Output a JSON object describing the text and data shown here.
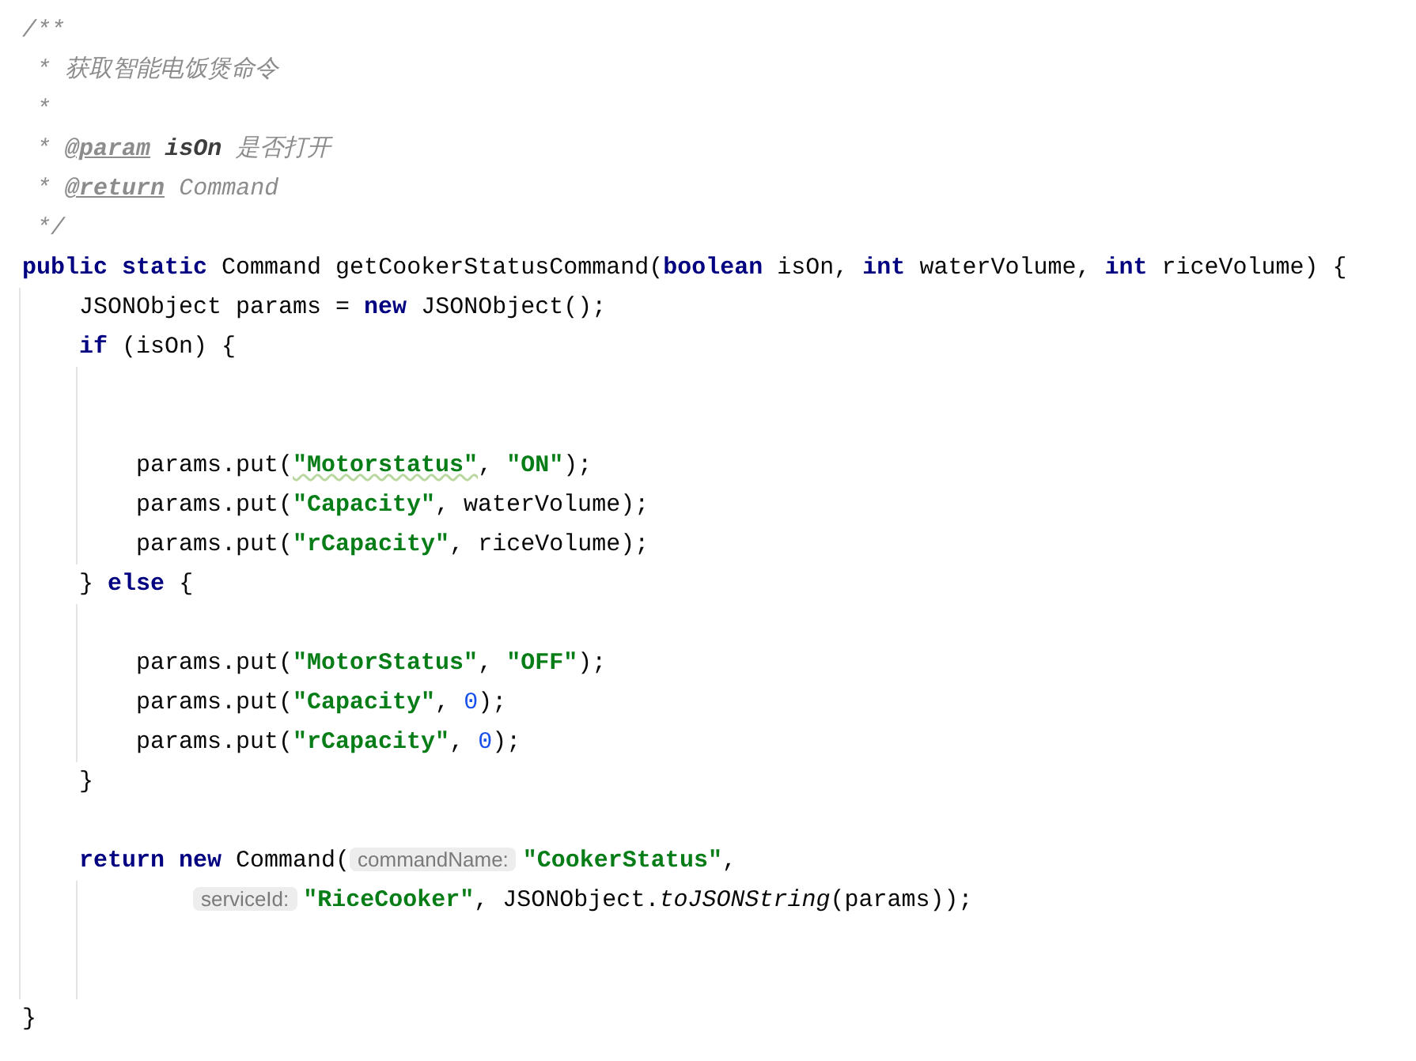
{
  "lines": [
    {
      "tokens": [
        {
          "kind": "comment",
          "text": "/**"
        }
      ]
    },
    {
      "doc": true,
      "tokens": [
        {
          "kind": "comment",
          "text": "*"
        },
        {
          "kind": "comment",
          "text": "获取智能电饭煲命令"
        }
      ]
    },
    {
      "doc": true,
      "tokens": [
        {
          "kind": "comment",
          "text": "*"
        }
      ]
    },
    {
      "doc": true,
      "tokens": [
        {
          "kind": "comment",
          "text": "*"
        },
        {
          "kind": "doc_tag",
          "text": "@param"
        },
        {
          "kind": "doc_name",
          "text": "isOn"
        },
        {
          "kind": "comment",
          "text": "是否打开"
        }
      ]
    },
    {
      "doc": true,
      "tokens": [
        {
          "kind": "comment",
          "text": "*"
        },
        {
          "kind": "doc_tag",
          "text": "@return"
        },
        {
          "kind": "comment",
          "text": "Command"
        }
      ]
    },
    {
      "doc": true,
      "tokens": [
        {
          "kind": "comment",
          "text": "*/"
        }
      ]
    },
    {
      "tokens": [
        {
          "kind": "keyword",
          "text": "public static"
        },
        {
          "kind": "plain",
          "text": "Command getCookerStatusCommand("
        },
        {
          "kind": "keyword",
          "text": "boolean"
        },
        {
          "kind": "plain",
          "text": "isOn,"
        },
        {
          "kind": "keyword",
          "text": "int"
        },
        {
          "kind": "plain",
          "text": "waterVolume,"
        },
        {
          "kind": "keyword",
          "text": "int"
        },
        {
          "kind": "plain",
          "text": "riceVolume) {"
        }
      ],
      "children": [
        {
          "tokens": [
            {
              "kind": "plain",
              "text": "JSONObject params = "
            },
            {
              "kind": "keyword",
              "text": "new"
            },
            {
              "kind": "plain",
              "text": "JSONObject();"
            }
          ]
        },
        {
          "tokens": [
            {
              "kind": "keyword",
              "text": "if"
            },
            {
              "kind": "plain",
              "text": "(isOn) {"
            }
          ],
          "children": [
            {
              "blank": true
            },
            {
              "blank": true
            },
            {
              "tokens": [
                {
                  "kind": "plain",
                  "text": "params.put("
                },
                {
                  "kind": "string",
                  "text": "\"Motorstatus\"",
                  "warning": true
                },
                {
                  "kind": "plain",
                  "text": ", "
                },
                {
                  "kind": "string",
                  "text": "\"ON\""
                },
                {
                  "kind": "plain",
                  "text": ");"
                }
              ]
            },
            {
              "tokens": [
                {
                  "kind": "plain",
                  "text": "params.put("
                },
                {
                  "kind": "string",
                  "text": "\"Capacity\""
                },
                {
                  "kind": "plain",
                  "text": ", waterVolume);"
                }
              ]
            },
            {
              "tokens": [
                {
                  "kind": "plain",
                  "text": "params.put("
                },
                {
                  "kind": "string",
                  "text": "\"rCapacity\""
                },
                {
                  "kind": "plain",
                  "text": ", riceVolume);"
                }
              ]
            }
          ]
        },
        {
          "tokens": [
            {
              "kind": "plain",
              "text": "}"
            },
            {
              "kind": "keyword",
              "text": "else"
            },
            {
              "kind": "plain",
              "text": "{"
            }
          ],
          "children": [
            {
              "blank": true
            },
            {
              "tokens": [
                {
                  "kind": "plain",
                  "text": "params.put("
                },
                {
                  "kind": "string",
                  "text": "\"MotorStatus\""
                },
                {
                  "kind": "plain",
                  "text": ", "
                },
                {
                  "kind": "string",
                  "text": "\"OFF\""
                },
                {
                  "kind": "plain",
                  "text": ");"
                }
              ]
            },
            {
              "tokens": [
                {
                  "kind": "plain",
                  "text": "params.put("
                },
                {
                  "kind": "string",
                  "text": "\"Capacity\""
                },
                {
                  "kind": "plain",
                  "text": ", "
                },
                {
                  "kind": "number",
                  "text": "0"
                },
                {
                  "kind": "plain",
                  "text": ");"
                }
              ]
            },
            {
              "tokens": [
                {
                  "kind": "plain",
                  "text": "params.put("
                },
                {
                  "kind": "string",
                  "text": "\"rCapacity\""
                },
                {
                  "kind": "plain",
                  "text": ", "
                },
                {
                  "kind": "number",
                  "text": "0"
                },
                {
                  "kind": "plain",
                  "text": ");"
                }
              ]
            }
          ]
        },
        {
          "tokens": [
            {
              "kind": "plain",
              "text": "}"
            }
          ]
        },
        {
          "blank": true
        },
        {
          "tokens": [
            {
              "kind": "keyword",
              "text": "return new"
            },
            {
              "kind": "plain",
              "text": "Command("
            },
            {
              "kind": "hint",
              "text": "commandName:"
            },
            {
              "kind": "string",
              "text": "\"CookerStatus\""
            },
            {
              "kind": "plain",
              "text": ","
            }
          ],
          "continuation": true,
          "children": [
            {
              "tokens": [
                {
                  "kind": "hint",
                  "text": "serviceId:"
                },
                {
                  "kind": "string",
                  "text": "\"RiceCooker\""
                },
                {
                  "kind": "plain",
                  "text": ", JSONObject."
                },
                {
                  "kind": "static_call",
                  "text": "toJSONString"
                },
                {
                  "kind": "plain",
                  "text": "(params));"
                }
              ]
            },
            {
              "blank": true
            },
            {
              "blank": true
            }
          ]
        }
      ]
    },
    {
      "tokens": [
        {
          "kind": "plain",
          "text": "}"
        }
      ]
    }
  ]
}
